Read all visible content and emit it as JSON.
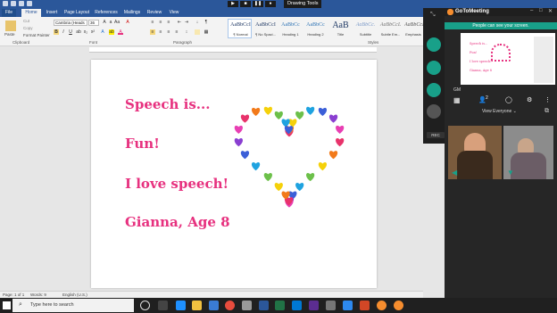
{
  "word": {
    "title_bar": {
      "drawing_tools": "Drawing Tools"
    },
    "tabs": [
      "File",
      "Home",
      "Insert",
      "Page Layout",
      "References",
      "Mailings",
      "Review",
      "View"
    ],
    "active_tab": "Home",
    "clipboard": {
      "cut": "Cut",
      "copy": "Copy",
      "paste": "Paste",
      "format_painter": "Format Painter",
      "label": "Clipboard"
    },
    "font": {
      "name": "Cambria (Heads",
      "size": "36",
      "label": "Font"
    },
    "paragraph": {
      "label": "Paragraph"
    },
    "styles": {
      "label": "Styles",
      "items": [
        {
          "sample": "AaBbCcI",
          "name": "¶ Normal"
        },
        {
          "sample": "AaBbCcI",
          "name": "¶ No Spaci..."
        },
        {
          "sample": "AaBbCc",
          "name": "Heading 1"
        },
        {
          "sample": "AaBbCc",
          "name": "Heading 2"
        },
        {
          "sample": "AaB",
          "name": "Title"
        },
        {
          "sample": "AaBbCc.",
          "name": "Subtitle"
        },
        {
          "sample": "AaBbCcL",
          "name": "Subtle Em..."
        },
        {
          "sample": "AaBbCcL",
          "name": "Emphasis"
        }
      ]
    },
    "document": {
      "lines": [
        "Speech is...",
        "Fun!",
        "I love speech!",
        "Gianna, Age 8"
      ],
      "text_color": "#e7317f"
    },
    "status": {
      "page": "Page: 1 of 1",
      "words": "Words: 9",
      "language": "English (U.S.)"
    }
  },
  "taskbar": {
    "search_placeholder": "Type here to search"
  },
  "gotomeeting": {
    "title": "GoToMeeting",
    "banner": "People can see your screen.",
    "preview_lines": [
      "Speech is...",
      "Fun!",
      "I love speech!",
      "Gianna, Age 8"
    ],
    "organizer": "GM",
    "attendee_count": "2",
    "view": "View Everyone",
    "rec": "REC",
    "accent": "#18a089"
  }
}
